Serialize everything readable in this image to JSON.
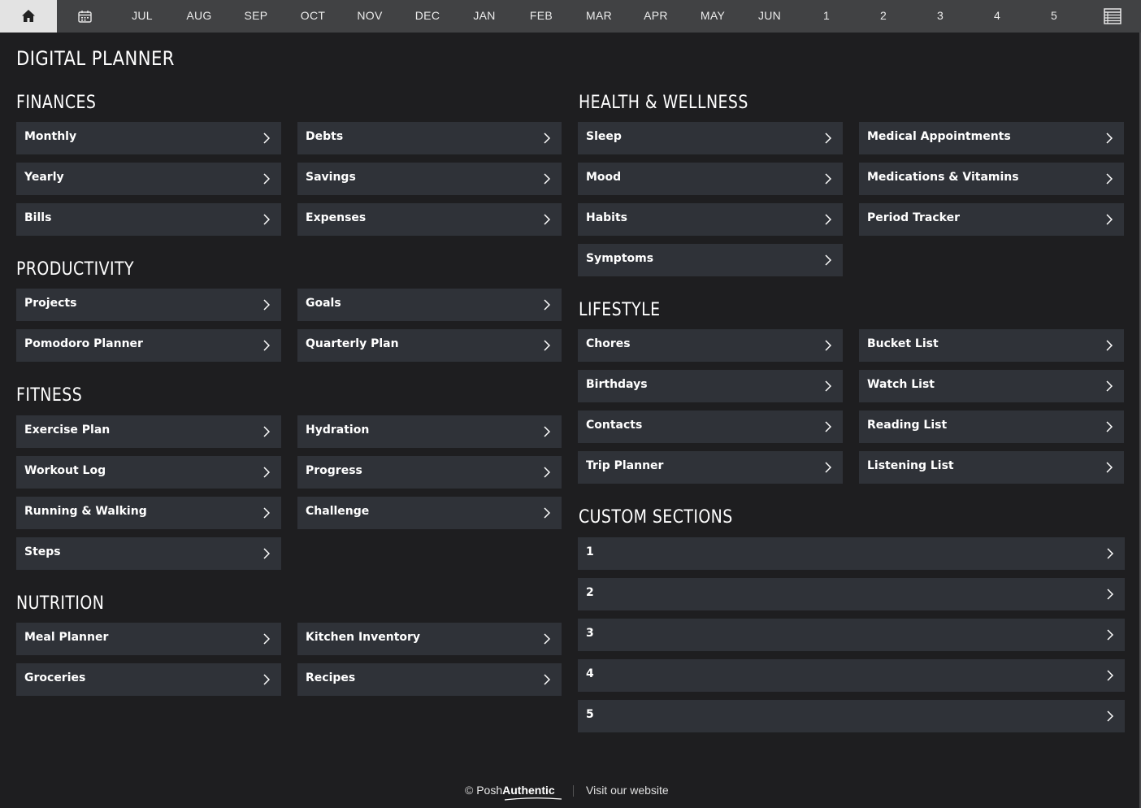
{
  "nav": {
    "home_icon": "home-icon",
    "calendar_icon": "calendar-icon",
    "months": [
      "JUL",
      "AUG",
      "SEP",
      "OCT",
      "NOV",
      "DEC",
      "JAN",
      "FEB",
      "MAR",
      "APR",
      "MAY",
      "JUN"
    ],
    "numbers": [
      "1",
      "2",
      "3",
      "4",
      "5"
    ],
    "notes_icon": "notes-icon"
  },
  "page_title": "DIGITAL PLANNER",
  "sections": {
    "finances": {
      "title": "FINANCES",
      "items": [
        "Monthly",
        "Debts",
        "Yearly",
        "Savings",
        "Bills",
        "Expenses"
      ]
    },
    "productivity": {
      "title": "PRODUCTIVITY",
      "items": [
        "Projects",
        "Goals",
        "Pomodoro Planner",
        "Quarterly Plan"
      ]
    },
    "fitness": {
      "title": "FITNESS",
      "items": [
        "Exercise Plan",
        "Hydration",
        "Workout Log",
        "Progress",
        "Running & Walking",
        "Challenge",
        "Steps"
      ]
    },
    "nutrition": {
      "title": "NUTRITION",
      "items": [
        "Meal Planner",
        "Kitchen Inventory",
        "Groceries",
        "Recipes"
      ]
    },
    "health": {
      "title": "HEALTH & WELLNESS",
      "items": [
        "Sleep",
        "Medical Appointments",
        "Mood",
        "Medications & Vitamins",
        "Habits",
        "Period Tracker",
        "Symptoms"
      ]
    },
    "lifestyle": {
      "title": "LIFESTYLE",
      "items": [
        "Chores",
        "Bucket List",
        "Birthdays",
        "Watch List",
        "Contacts",
        "Reading List",
        "Trip Planner",
        "Listening List"
      ]
    },
    "custom": {
      "title": "CUSTOM SECTIONS",
      "items": [
        "1",
        "2",
        "3",
        "4",
        "5"
      ]
    }
  },
  "footer": {
    "copyright_symbol": "©",
    "brand_part1": "Posh",
    "brand_part2": "Authentic",
    "visit_link": "Visit our website"
  },
  "colors": {
    "background": "#1e1e20",
    "nav_bar": "#414244",
    "nav_home_active": "#e3e3e3",
    "tile": "#2f3238",
    "text": "#ffffff"
  }
}
